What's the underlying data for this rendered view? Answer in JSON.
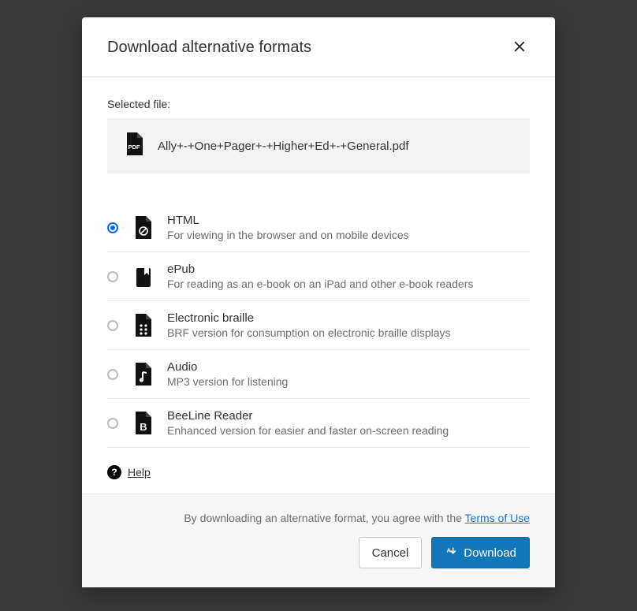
{
  "modal": {
    "title": "Download alternative formats",
    "selected_label": "Selected file:",
    "file_name": "Ally+-+One+Pager+-+Higher+Ed+-+General.pdf",
    "help_label": "Help"
  },
  "options": [
    {
      "title": "HTML",
      "desc": "For viewing in the browser and on mobile devices"
    },
    {
      "title": "ePub",
      "desc": "For reading as an e-book on an iPad and other e-book readers"
    },
    {
      "title": "Electronic braille",
      "desc": "BRF version for consumption on electronic braille displays"
    },
    {
      "title": "Audio",
      "desc": "MP3 version for listening"
    },
    {
      "title": "BeeLine Reader",
      "desc": "Enhanced version for easier and faster on-screen reading"
    }
  ],
  "footer": {
    "disclaimer_prefix": "By downloading an alternative format, you agree with the ",
    "terms": "Terms of Use",
    "cancel": "Cancel",
    "download": "Download"
  }
}
